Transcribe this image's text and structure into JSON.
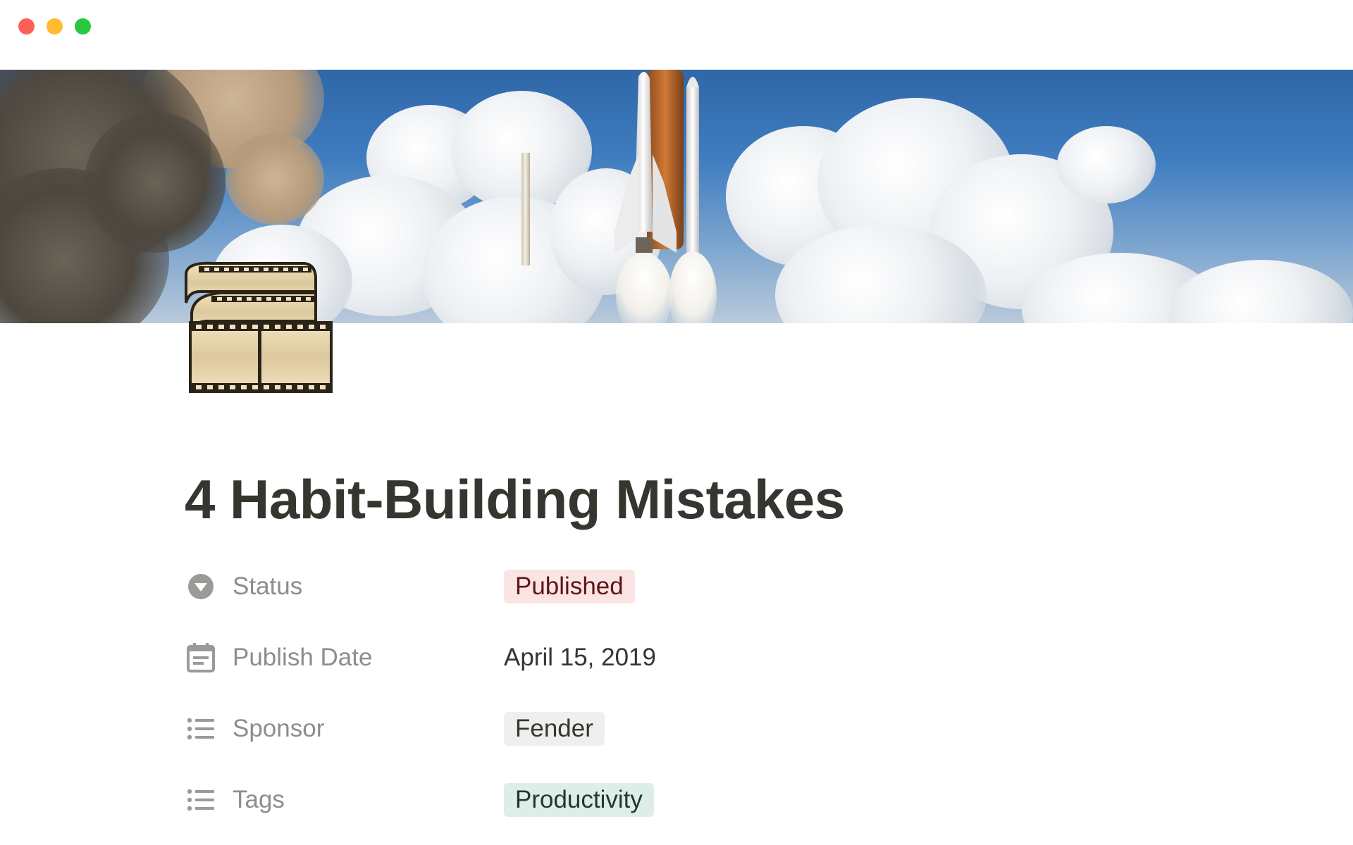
{
  "window": {
    "controls": [
      "close",
      "minimize",
      "maximize"
    ]
  },
  "page": {
    "cover": "space-shuttle-launch",
    "icon": "film-strip-icon",
    "title": "4 Habit-Building Mistakes"
  },
  "properties": [
    {
      "icon": "status-icon",
      "name": "Status",
      "value": "Published",
      "style": "tag",
      "bg": "#fbe4e4",
      "fg": "#5d1715"
    },
    {
      "icon": "calendar-icon",
      "name": "Publish Date",
      "value": "April 15, 2019",
      "style": "text"
    },
    {
      "icon": "list-icon",
      "name": "Sponsor",
      "value": "Fender",
      "style": "tag",
      "bg": "#efefee",
      "fg": "#37352f"
    },
    {
      "icon": "list-icon",
      "name": "Tags",
      "value": "Productivity",
      "style": "tag",
      "bg": "#ddedea",
      "fg": "#1f3a29"
    }
  ]
}
